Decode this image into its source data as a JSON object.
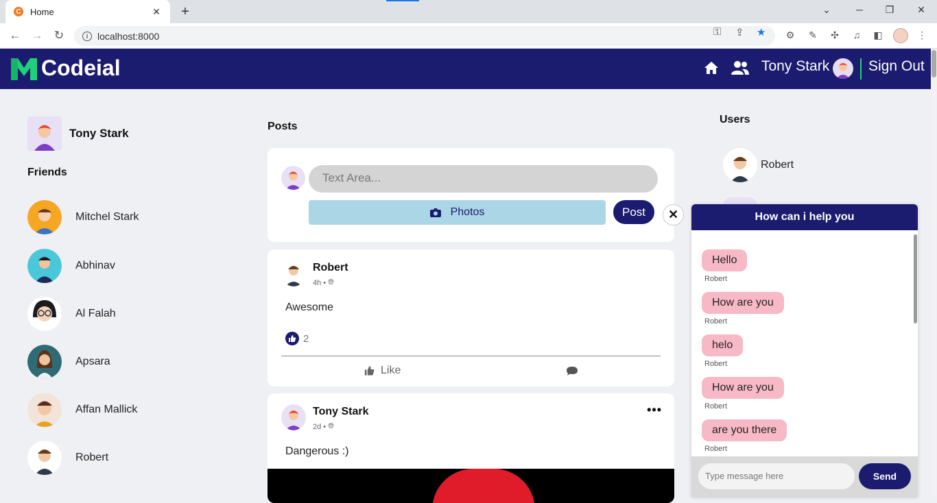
{
  "browser": {
    "tab_title": "Home",
    "url": "localhost:8000",
    "favicon_letter": "C"
  },
  "header": {
    "brand": "Codeial",
    "user_name": "Tony Stark",
    "sign_out": "Sign Out",
    "brand_color": "#1b1b6f"
  },
  "profile": {
    "name": "Tony Stark"
  },
  "friends": {
    "heading": "Friends",
    "items": [
      {
        "name": "Mitchel Stark"
      },
      {
        "name": "Abhinav"
      },
      {
        "name": "Al Falah"
      },
      {
        "name": "Apsara"
      },
      {
        "name": "Affan Mallick"
      },
      {
        "name": "Robert"
      }
    ]
  },
  "posts": {
    "heading": "Posts",
    "create": {
      "placeholder": "Text Area...",
      "photos_label": "Photos",
      "post_label": "Post"
    },
    "items": [
      {
        "author": "Robert",
        "time": "4h",
        "content": "Awesome",
        "likes": "2",
        "like_label": "Like"
      },
      {
        "author": "Tony Stark",
        "time": "2d",
        "content": "Dangerous :)"
      }
    ]
  },
  "users": {
    "heading": "Users",
    "items": [
      {
        "name": "Robert"
      }
    ]
  },
  "chat": {
    "title": "How can i help you",
    "messages": [
      {
        "text": "Hello",
        "sender": "Robert"
      },
      {
        "text": "How are you",
        "sender": "Robert"
      },
      {
        "text": "helo",
        "sender": "Robert"
      },
      {
        "text": "How are you",
        "sender": "Robert"
      },
      {
        "text": "are you there",
        "sender": "Robert"
      }
    ],
    "input_placeholder": "Type message here",
    "send_label": "Send"
  }
}
